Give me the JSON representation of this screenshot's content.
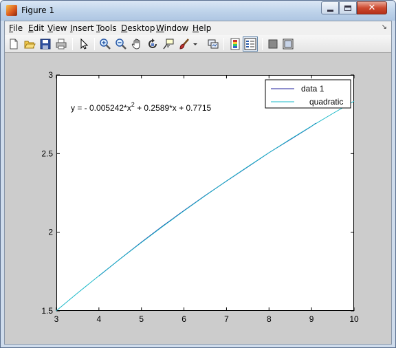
{
  "window": {
    "title": "Figure 1",
    "icons": {
      "app": "matlab-figure-icon",
      "minimize": "minimize-icon",
      "maximize": "maximize-icon",
      "close": "close-icon"
    }
  },
  "menubar": {
    "items": [
      {
        "key": "F",
        "rest": "ile"
      },
      {
        "key": "E",
        "rest": "dit"
      },
      {
        "key": "V",
        "rest": "iew"
      },
      {
        "key": "I",
        "rest": "nsert"
      },
      {
        "key": "T",
        "rest": "ools"
      },
      {
        "key": "D",
        "rest": "esktop"
      },
      {
        "key": "W",
        "rest": "indow"
      },
      {
        "key": "H",
        "rest": "elp"
      }
    ],
    "dock_icon": "dock-arrow-icon"
  },
  "toolbar": {
    "icons": [
      "new-figure-icon",
      "open-file-icon",
      "save-icon",
      "print-icon",
      "edit-plot-arrow-icon",
      "zoom-in-icon",
      "zoom-out-icon",
      "pan-hand-icon",
      "rotate-3d-icon",
      "data-cursor-icon",
      "brush-icon",
      "brush-dropdown-icon",
      "link-plot-icon",
      "insert-colorbar-icon",
      "insert-legend-icon",
      "hide-plot-tools-icon",
      "show-plot-tools-icon"
    ]
  },
  "colors": {
    "data1": "#1f1f9e",
    "quadratic": "#18b8c8",
    "figure_bg": "#cccccc"
  },
  "chart_data": {
    "type": "line",
    "xlim": [
      3,
      10
    ],
    "ylim": [
      1.5,
      3
    ],
    "xticks": [
      "3",
      "4",
      "5",
      "6",
      "7",
      "8",
      "9",
      "10"
    ],
    "yticks": [
      "1.5",
      "2",
      "2.5",
      "3"
    ],
    "grid": false,
    "legend_position": "top-right",
    "annotation": {
      "prefix": "y = - 0.005242*x",
      "sup": "2",
      "suffix": " + 0.2589*x + 0.7715"
    },
    "series": [
      {
        "name": "data 1",
        "x": [
          4,
          4.5,
          5,
          5.5,
          6,
          6.5,
          7,
          7.5,
          8,
          8.5,
          9,
          9.1
        ],
        "y": [
          1.722,
          1.8304,
          1.9364,
          2.0396,
          2.1377,
          2.2332,
          2.3251,
          2.4154,
          2.5057,
          2.5895,
          2.6733,
          2.6935
        ]
      },
      {
        "name": "quadratic",
        "x": [
          3,
          3.5,
          4,
          4.5,
          5,
          5.5,
          6,
          6.5,
          7,
          7.5,
          8,
          8.5,
          9,
          9.5,
          10
        ],
        "y": [
          1.501,
          1.6135,
          1.7232,
          1.8303,
          1.9348,
          2.0366,
          2.1357,
          2.2322,
          2.326,
          2.4172,
          2.5057,
          2.5915,
          2.6747,
          2.7553,
          2.8333
        ]
      }
    ]
  }
}
